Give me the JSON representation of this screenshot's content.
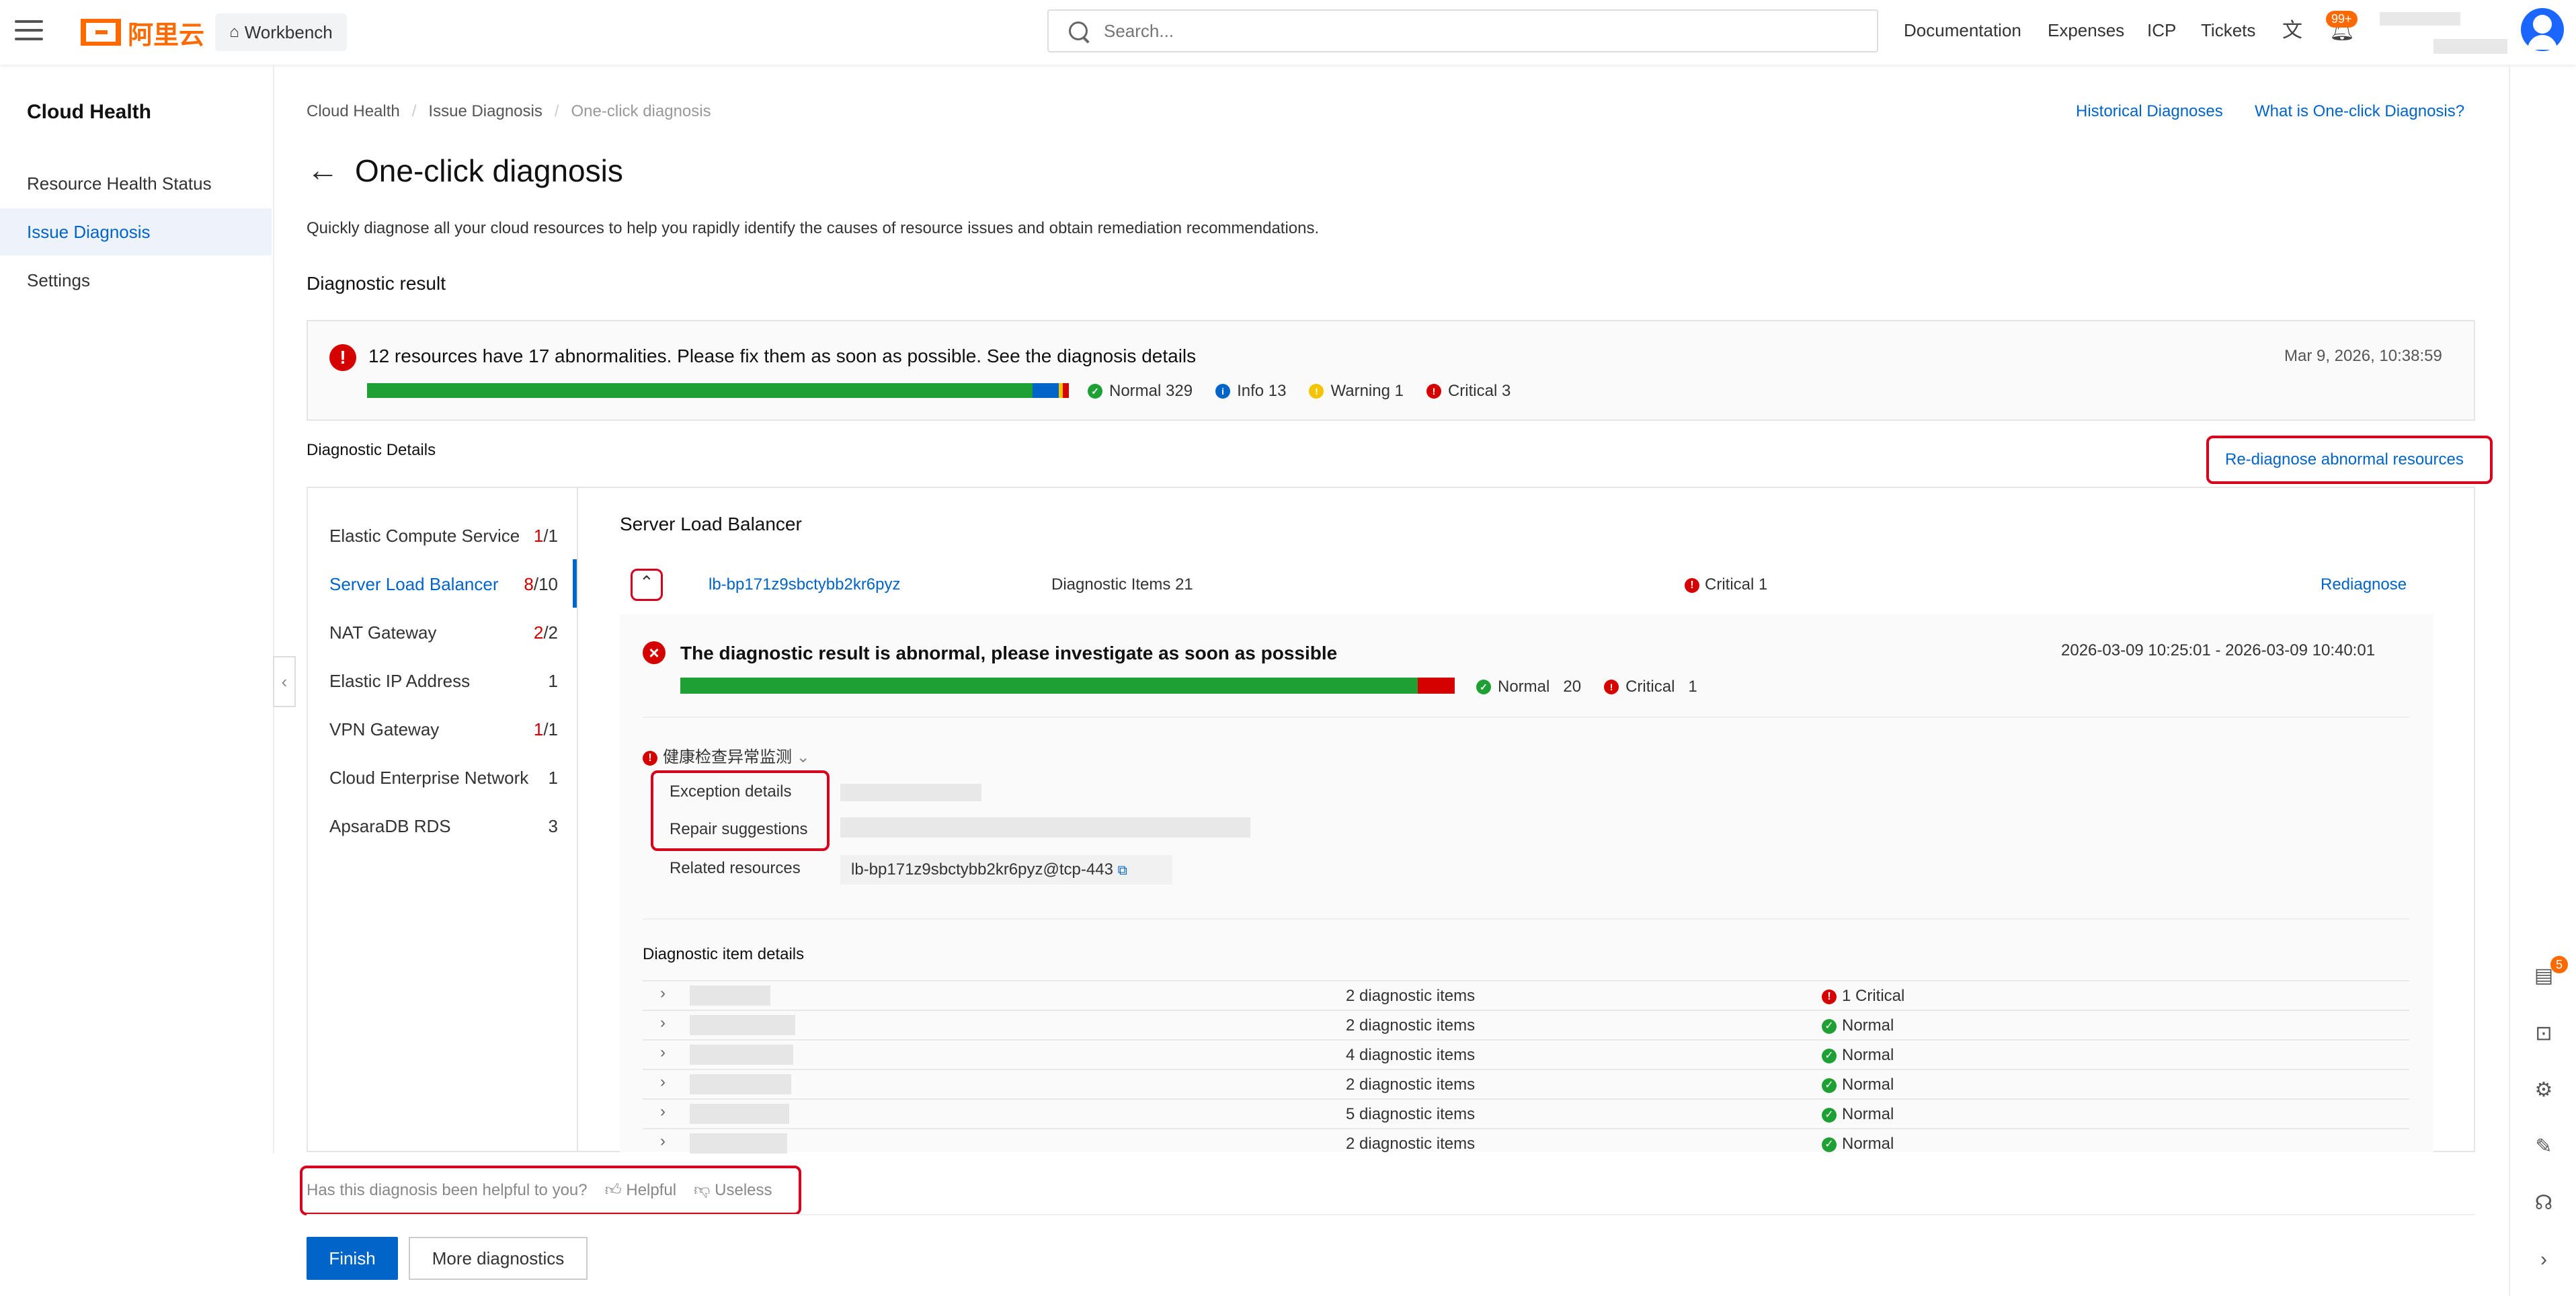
{
  "topbar": {
    "logo_text": "阿里云",
    "workbench": "Workbench",
    "search_placeholder": "Search...",
    "links": [
      "Documentation",
      "Expenses",
      "ICP",
      "Tickets"
    ],
    "notif_badge": "99+"
  },
  "sidebar": {
    "title": "Cloud Health",
    "items": [
      {
        "label": "Resource Health Status"
      },
      {
        "label": "Issue Diagnosis"
      },
      {
        "label": "Settings"
      }
    ]
  },
  "breadcrumb": [
    "Cloud Health",
    "Issue Diagnosis",
    "One-click diagnosis"
  ],
  "header_links": {
    "history": "Historical Diagnoses",
    "what": "What is One-click Diagnosis?"
  },
  "page": {
    "title": "One-click diagnosis",
    "description": "Quickly diagnose all your cloud resources to help you rapidly identify the causes of resource issues and obtain remediation recommendations.",
    "result_heading": "Diagnostic result",
    "details_heading": "Diagnostic Details",
    "rediagnose_all": "Re-diagnose abnormal resources"
  },
  "summary": {
    "message": "12 resources have 17 abnormalities. Please fix them as soon as possible. See the diagnosis details",
    "timestamp": "Mar 9, 2026, 10:38:59",
    "legend": [
      {
        "label": "Normal 329",
        "value": 329,
        "color": "#1ea034",
        "symbol": "✓"
      },
      {
        "label": "Info 13",
        "value": 13,
        "color": "#0064c8",
        "symbol": "i"
      },
      {
        "label": "Warning 1",
        "value": 1,
        "color": "#f5c400",
        "symbol": "!"
      },
      {
        "label": "Critical 3",
        "value": 3,
        "color": "#d50000",
        "symbol": "!"
      }
    ]
  },
  "services": [
    {
      "name": "Elastic Compute Service",
      "abn": "1",
      "total": "/1"
    },
    {
      "name": "Server Load Balancer",
      "abn": "8",
      "total": "/10"
    },
    {
      "name": "NAT Gateway",
      "abn": "2",
      "total": "/2"
    },
    {
      "name": "Elastic IP Address",
      "abn": "",
      "total": "1"
    },
    {
      "name": "VPN Gateway",
      "abn": "1",
      "total": "/1"
    },
    {
      "name": "Cloud Enterprise Network",
      "abn": "",
      "total": "1"
    },
    {
      "name": "ApsaraDB RDS",
      "abn": "",
      "total": "3"
    }
  ],
  "detail": {
    "section_title": "Server Load Balancer",
    "instance_id": "lb-bp171z9sbctybb2kr6pyz",
    "diag_items": "Diagnostic Items 21",
    "critical": "Critical 1",
    "rediagnose": "Rediagnose",
    "result_msg": "The diagnostic result is abnormal, please investigate as soon as possible",
    "time_range": "2026-03-09 10:25:01 - 2026-03-09 10:40:01",
    "normal_label": "Normal",
    "normal_count": "20",
    "critical_label": "Critical",
    "critical_count": "1",
    "normal_value": 20,
    "critical_value": 1,
    "check_name": "健康检查异常监测",
    "exception_label": "Exception details",
    "repair_label": "Repair suggestions",
    "related_label": "Related resources",
    "related_value": "lb-bp171z9sbctybb2kr6pyz@tcp-443",
    "item_details_heading": "Diagnostic item details"
  },
  "item_rows": [
    {
      "count": "2 diagnostic items",
      "status": "1 Critical",
      "type": "critical"
    },
    {
      "count": "2 diagnostic items",
      "status": "Normal",
      "type": "normal"
    },
    {
      "count": "4 diagnostic items",
      "status": "Normal",
      "type": "normal"
    },
    {
      "count": "2 diagnostic items",
      "status": "Normal",
      "type": "normal"
    },
    {
      "count": "5 diagnostic items",
      "status": "Normal",
      "type": "normal"
    },
    {
      "count": "2 diagnostic items",
      "status": "Normal",
      "type": "normal"
    }
  ],
  "feedback": {
    "question": "Has this diagnosis been helpful to you?",
    "helpful": "Helpful",
    "useless": "Useless"
  },
  "buttons": {
    "finish": "Finish",
    "more": "More diagnostics"
  },
  "rail_badge": "5"
}
